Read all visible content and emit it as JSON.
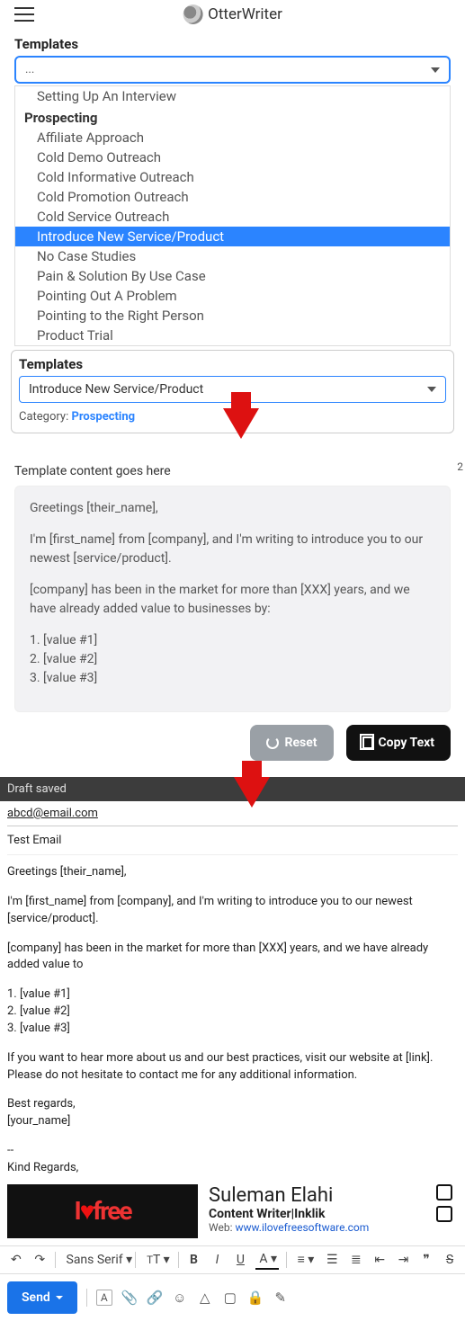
{
  "brand": "OtterWriter",
  "section1_label": "Templates",
  "dd1_value": "...",
  "dd1_preitem": "Setting Up An Interview",
  "dd1_category": "Prospecting",
  "dd1_items": [
    "Affiliate Approach",
    "Cold Demo Outreach",
    "Cold Informative Outreach",
    "Cold Promotion Outreach",
    "Cold Service Outreach",
    "Introduce New Service/Product",
    "No Case Studies",
    "Pain & Solution By Use Case",
    "Pointing Out A Problem",
    "Pointing to the Right Person",
    "Product Trial"
  ],
  "dd1_selected_index": 5,
  "section2_label": "Templates",
  "dd2_value": "Introduce New Service/Product",
  "cat_prefix": "Category: ",
  "cat_value": "Prospecting",
  "tmpl_head": "Template content goes here",
  "tmpl_body": {
    "p1": "Greetings [their_name],",
    "p2": "I'm [first_name] from [company], and I'm writing to introduce you to our newest [service/product].",
    "p3": "[company] has been in the market for more than [XXX] years, and we have already added value to businesses by:",
    "l1": "1. [value #1]",
    "l2": "2. [value #2]",
    "l3": "3. [value #3]"
  },
  "reset_label": "Reset",
  "copy_label": "Copy Text",
  "draft_saved": "Draft saved",
  "email_to": "abcd@email.com",
  "email_subject": "Test Email",
  "email": {
    "p1": "Greetings [their_name],",
    "p2": "I'm [first_name] from [company], and I'm writing to introduce you to our newest [service/product].",
    "p3": "[company] has been in the market for more than [XXX] years, and we have already added value to",
    "l1": "1. [value #1]",
    "l2": "2. [value #2]",
    "l3": "3. [value #3]",
    "p4a": "If you want to hear more about us and our best practices, visit our website at [link].",
    "p4b": "Please do not hesitate to contact me for any additional information.",
    "p5a": "Best regards,",
    "p5b": "[your_name]",
    "dash": "--",
    "kr": "Kind Regards,"
  },
  "sig": {
    "logo_a": "I",
    "logo_b": "free",
    "name": "Suleman Elahi",
    "role": "Content Writer|Inklik",
    "web_label": "Web: ",
    "web_url": "www.ilovefreesoftware.com"
  },
  "font_family_label": "Sans Serif",
  "send_label": "Send",
  "side_num": "2"
}
